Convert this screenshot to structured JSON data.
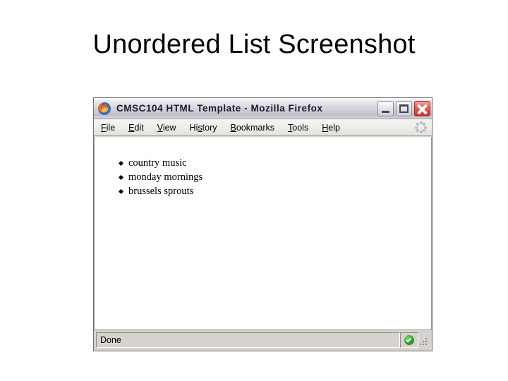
{
  "slide": {
    "title": "Unordered List Screenshot",
    "background_color": "#ffffff"
  },
  "browser_window": {
    "title_bar": {
      "title": "CMSC104 HTML Template - Mozilla Firefox",
      "app_icon": "firefox-icon",
      "controls": [
        {
          "name": "minimize",
          "label": "_"
        },
        {
          "name": "maximize",
          "label": "□"
        },
        {
          "name": "close",
          "label": "✕"
        }
      ]
    },
    "menu_bar": {
      "items": [
        {
          "label": "File",
          "accel": "F"
        },
        {
          "label": "Edit",
          "accel": "E"
        },
        {
          "label": "View",
          "accel": "V"
        },
        {
          "label": "History",
          "accel": "s"
        },
        {
          "label": "Bookmarks",
          "accel": "B"
        },
        {
          "label": "Tools",
          "accel": "T"
        },
        {
          "label": "Help",
          "accel": "H"
        }
      ],
      "throbber": "throbber-icon"
    },
    "content": {
      "background_color": "#ffffff",
      "list_type": "unordered",
      "list_items": [
        "country music",
        "monday mornings",
        "brussels sprouts"
      ]
    },
    "status_bar": {
      "status_text": "Done",
      "secure_icon": "green-check-icon",
      "resize_grip": "resize-grip-icon"
    },
    "colors": {
      "title_bar_gradient_light": "#fdfdfd",
      "title_bar_gradient_dark": "#c0bdc9",
      "chrome": "#d6d3ce",
      "menu_bar": "#eeece7",
      "border": "#9a98a4",
      "close_button": "#c9342c",
      "secure_green": "#2aa02a"
    }
  }
}
